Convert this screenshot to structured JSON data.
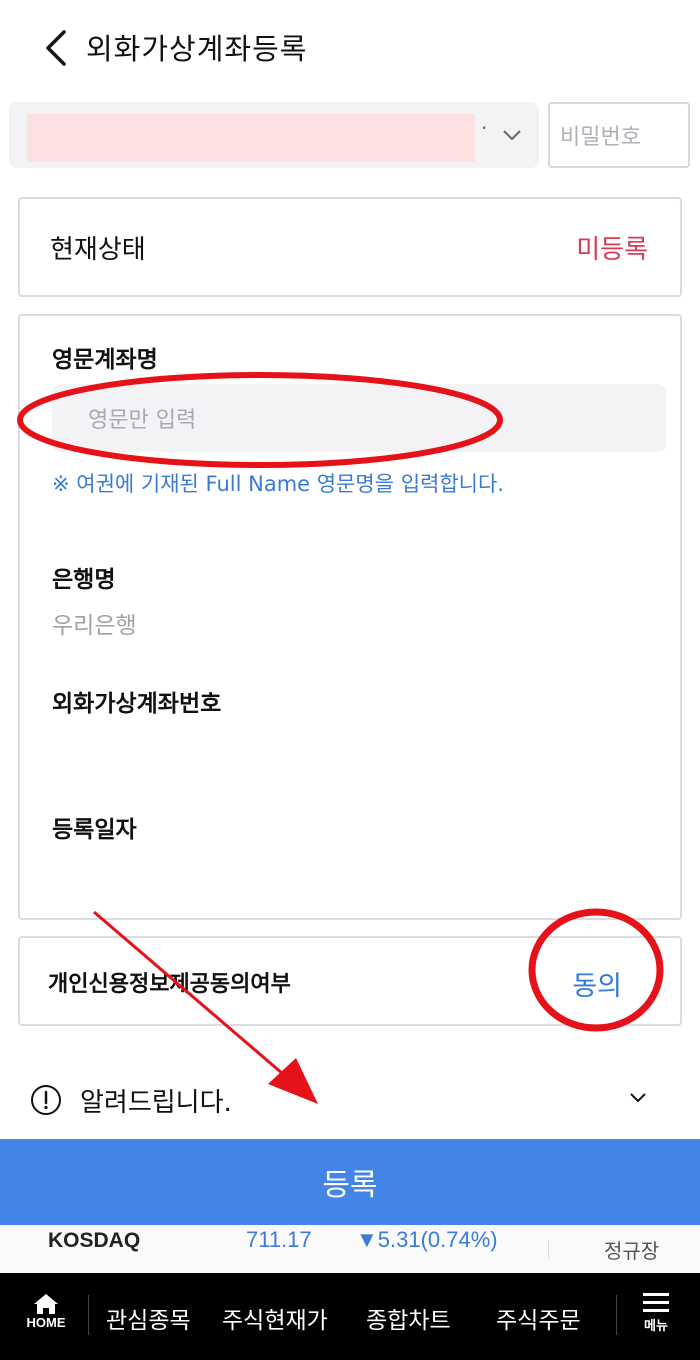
{
  "header": {
    "title": "외화가상계좌등록"
  },
  "account": {
    "masked_dot": "·",
    "password_placeholder": "비밀번호"
  },
  "status": {
    "label": "현재상태",
    "value": "미등록"
  },
  "form": {
    "english_name_label": "영문계좌명",
    "english_name_placeholder": "영문만 입력",
    "english_name_notice": "※ 여권에 기재된 Full Name 영문명을 입력합니다.",
    "bank_label": "은행명",
    "bank_value": "우리은행",
    "virtual_account_label": "외화가상계좌번호",
    "registration_date_label": "등록일자"
  },
  "consent": {
    "label": "개인신용정보제공동의여부",
    "value": "동의"
  },
  "notice": {
    "title": "알려드립니다."
  },
  "register_button": "등록",
  "ticker": {
    "name": "KOSDAQ",
    "value": "711.17",
    "change": "▼5.31(0.74%)",
    "market": "정규장"
  },
  "bottom_nav": {
    "home": "HOME",
    "items": [
      "관심종목",
      "주식현재가",
      "종합차트",
      "주식주문"
    ],
    "menu": "메뉴"
  },
  "colors": {
    "accent": "#4285e6",
    "status_unregistered": "#d83a54",
    "link_blue": "#2f7bd9",
    "annotation_red": "#e5121a"
  }
}
